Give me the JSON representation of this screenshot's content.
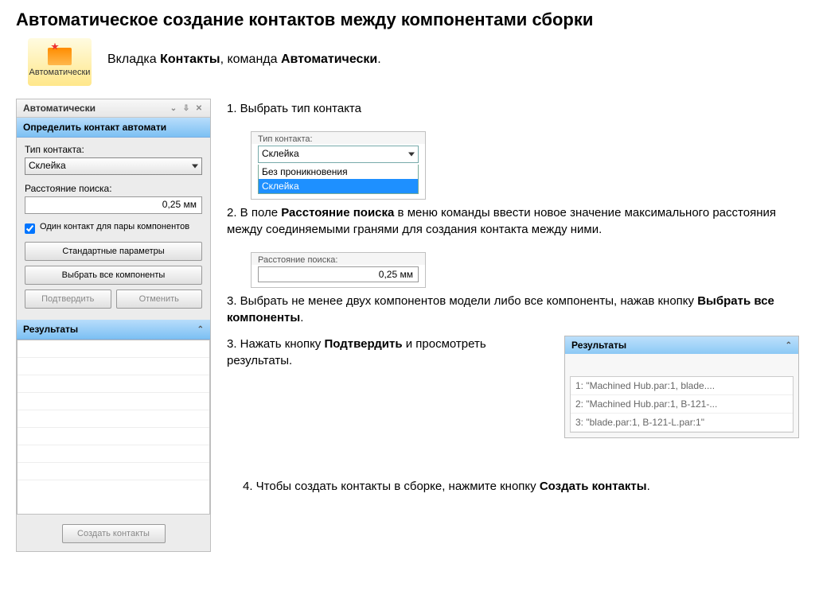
{
  "title": "Автоматическое создание контактов между компонентами сборки",
  "iconBtn": {
    "label": "Автоматически"
  },
  "intro": {
    "pre": "Вкладка ",
    "b1": "Контакты",
    "mid": ", команда ",
    "b2": "Автоматически",
    "post": "."
  },
  "panel": {
    "title": "Автоматически",
    "header": "Определить контакт автомати",
    "typeLabel": "Тип контакта:",
    "typeValue": "Склейка",
    "distLabel": "Расстояние поиска:",
    "distValue": "0,25 мм",
    "checkboxLabel": "Один контакт для пары компонентов",
    "btnParams": "Стандартные параметры",
    "btnSelectAll": "Выбрать все компоненты",
    "btnConfirm": "Подтвердить",
    "btnCancel": "Отменить",
    "resultsHeader": "Результаты",
    "btnCreate": "Создать контакты"
  },
  "steps": {
    "s1": "1. Выбрать тип контакта",
    "inset1": {
      "label": "Тип контакта:",
      "value": "Склейка",
      "opt1": "Без проникновения",
      "opt2": "Склейка"
    },
    "s2a": "2. В поле ",
    "s2b": "Расстояние поиска",
    "s2c": " в меню команды ввести новое значение максимального расстояния между соединяемыми гранями для создания контакта между ними.",
    "inset2": {
      "label": "Расстояние поиска:",
      "value": "0,25 мм"
    },
    "s3a": "3. Выбрать не менее двух компонентов модели либо все компоненты, нажав кнопку ",
    "s3b": "Выбрать все компоненты",
    "s3c": ".",
    "s3d": "3. Нажать кнопку ",
    "s3e": "Подтвердить",
    "s3f": " и просмотреть результаты.",
    "resultsSnippet": {
      "header": "Результаты",
      "r1": "1: \"Machined Hub.par:1, blade....",
      "r2": "2: \"Machined Hub.par:1, B-121-...",
      "r3": "3: \"blade.par:1, B-121-L.par:1\""
    },
    "s4a": "4. Чтобы создать контакты в сборке, нажмите кнопку ",
    "s4b": "Создать контакты",
    "s4c": "."
  }
}
